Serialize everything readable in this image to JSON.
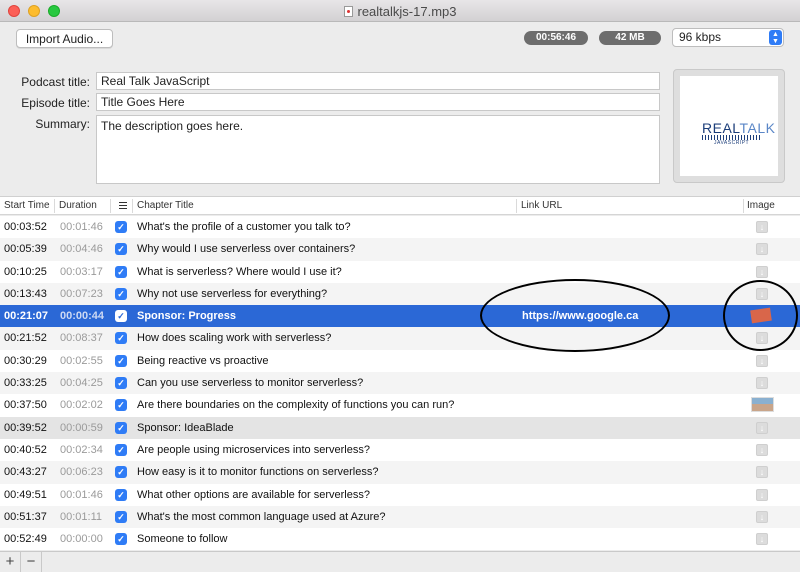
{
  "window": {
    "title": "realtalkjs-17.mp3"
  },
  "toolbar": {
    "import_label": "Import Audio...",
    "duration": "00:56:46",
    "file_size": "42 MB",
    "bitrate": "96 kbps"
  },
  "fields": {
    "podcast_title_label": "Podcast title:",
    "podcast_title": "Real Talk JavaScript",
    "episode_title_label": "Episode title:",
    "episode_title": "Title Goes Here",
    "summary_label": "Summary:",
    "summary": "The description goes here."
  },
  "artwork": {
    "main": "REAL",
    "main_thin": "TALK",
    "sub": "JAVASCRIPT"
  },
  "columns": {
    "start_time": "Start Time",
    "duration": "Duration",
    "chapter_title": "Chapter Title",
    "link_url": "Link URL",
    "image": "Image"
  },
  "chapters": [
    {
      "start": "00:03:52",
      "duration": "00:01:46",
      "title": "What's the profile of a customer you talk to?",
      "url": "",
      "image": "download-icon"
    },
    {
      "start": "00:05:39",
      "duration": "00:04:46",
      "title": "Why would I use serverless over containers?",
      "url": "",
      "image": "download-icon"
    },
    {
      "start": "00:10:25",
      "duration": "00:03:17",
      "title": "What is serverless? Where would I use it?",
      "url": "",
      "image": "download-icon"
    },
    {
      "start": "00:13:43",
      "duration": "00:07:23",
      "title": "Why not use serverless for everything?",
      "url": "",
      "image": "download-icon"
    },
    {
      "start": "00:21:07",
      "duration": "00:00:44",
      "title": "Sponsor: Progress",
      "url": "https://www.google.ca",
      "image": "sponsor-image"
    },
    {
      "start": "00:21:52",
      "duration": "00:08:37",
      "title": "How does scaling work with serverless?",
      "url": "",
      "image": "download-icon"
    },
    {
      "start": "00:30:29",
      "duration": "00:02:55",
      "title": "Being reactive vs proactive",
      "url": "",
      "image": "download-icon"
    },
    {
      "start": "00:33:25",
      "duration": "00:04:25",
      "title": "Can you use serverless to monitor serverless?",
      "url": "",
      "image": "download-icon"
    },
    {
      "start": "00:37:50",
      "duration": "00:02:02",
      "title": "Are there boundaries on the complexity of functions you can run?",
      "url": "",
      "image": "photo-thumbnail"
    },
    {
      "start": "00:39:52",
      "duration": "00:00:59",
      "title": "Sponsor: IdeaBlade",
      "url": "",
      "image": "download-icon"
    },
    {
      "start": "00:40:52",
      "duration": "00:02:34",
      "title": "Are people using microservices into serverless?",
      "url": "",
      "image": "download-icon"
    },
    {
      "start": "00:43:27",
      "duration": "00:06:23",
      "title": "How easy is it to monitor functions on serverless?",
      "url": "",
      "image": "download-icon"
    },
    {
      "start": "00:49:51",
      "duration": "00:01:46",
      "title": "What other options are available for serverless?",
      "url": "",
      "image": "download-icon"
    },
    {
      "start": "00:51:37",
      "duration": "00:01:11",
      "title": "What's the most common language used at Azure?",
      "url": "",
      "image": "download-icon"
    },
    {
      "start": "00:52:49",
      "duration": "00:00:00",
      "title": "Someone to follow",
      "url": "",
      "image": "download-icon"
    }
  ],
  "selected_row": 4,
  "colors": {
    "selection": "#2b68d6",
    "checkbox": "#2f7cf6",
    "annotation": "#000000"
  },
  "bottom_bar": {
    "add": "+",
    "remove": "−"
  }
}
